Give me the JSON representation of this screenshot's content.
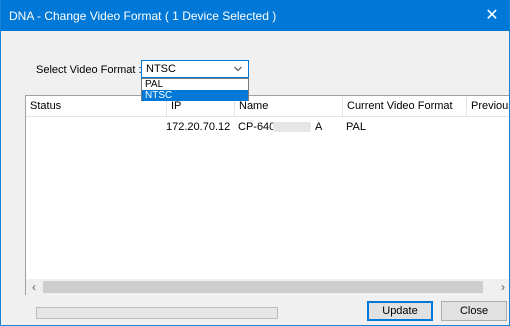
{
  "window": {
    "title": "DNA - Change Video Format ( 1 Device Selected )",
    "close_glyph": "✕"
  },
  "format": {
    "label": "Select Video Format :",
    "selected": "NTSC",
    "options": [
      "PAL",
      "NTSC"
    ],
    "highlighted_option": "NTSC"
  },
  "table": {
    "columns": [
      "Status",
      "IP",
      "Name",
      "Current Video Format",
      "Previous"
    ],
    "rows": [
      {
        "status": "",
        "ip": "172.20.70.12",
        "name_prefix": "CP-640",
        "name_suffix": "A",
        "current_format": "PAL",
        "previous": ""
      }
    ]
  },
  "progress": {
    "value_percent": 0
  },
  "buttons": {
    "update": "Update",
    "close": "Close"
  },
  "colors": {
    "accent": "#0078d7",
    "window_bg": "#f0f0f0",
    "progress_fill": "#06b025"
  },
  "icons": [
    "chevron-down-icon",
    "close-icon",
    "scroll-left-icon",
    "scroll-right-icon"
  ]
}
